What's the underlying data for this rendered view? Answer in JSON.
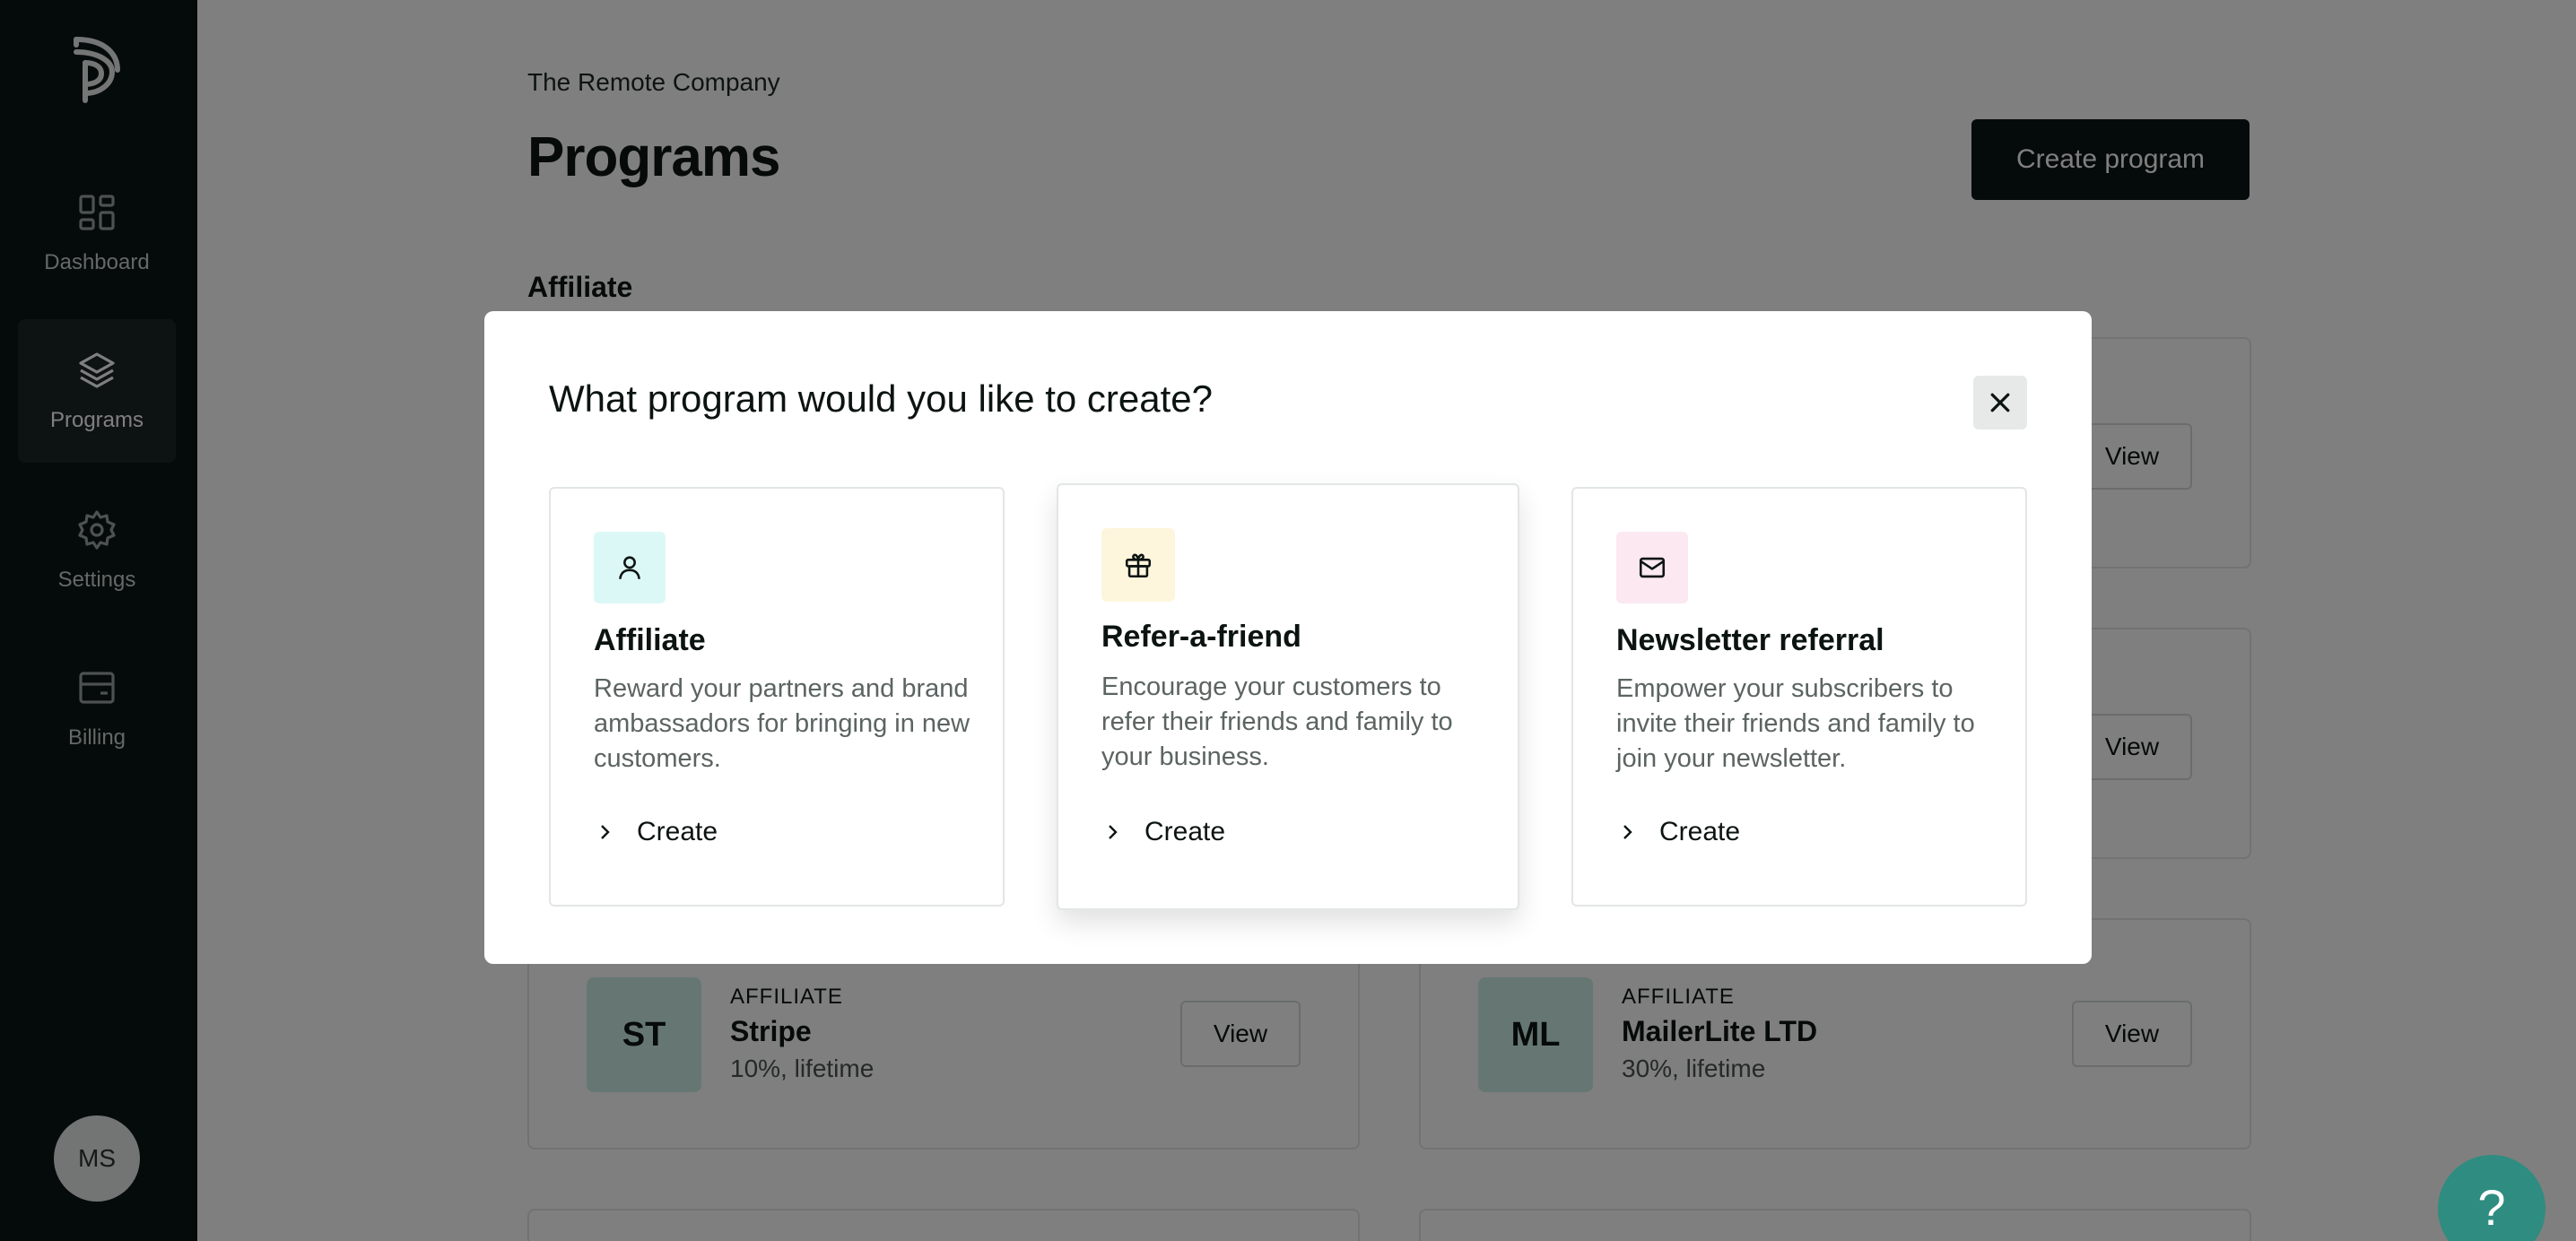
{
  "sidebar": {
    "items": [
      {
        "label": "Dashboard",
        "icon": "dashboard-icon"
      },
      {
        "label": "Programs",
        "icon": "layers-icon",
        "active": true
      },
      {
        "label": "Settings",
        "icon": "gear-icon"
      },
      {
        "label": "Billing",
        "icon": "billing-icon"
      }
    ],
    "avatar": "MS"
  },
  "header": {
    "company": "The Remote Company",
    "title": "Programs",
    "create_button": "Create program"
  },
  "section": {
    "title": "Affiliate"
  },
  "programs": [
    {
      "initials": "ST",
      "type": "AFFILIATE",
      "name": "Stripe",
      "terms": "10%, lifetime",
      "action": "View"
    },
    {
      "initials": "ML",
      "type": "AFFILIATE",
      "name": "MailerLite LTD",
      "terms": "30%, lifetime",
      "action": "View"
    }
  ],
  "partial_view_buttons": [
    "View",
    "View"
  ],
  "modal": {
    "title": "What program would you like to create?",
    "options": [
      {
        "title": "Affiliate",
        "description": "Reward your partners and brand ambassadors for bringing in new customers.",
        "action": "Create",
        "icon": "person-icon",
        "color": "#dcf8f6"
      },
      {
        "title": "Refer-a-friend",
        "description": "Encourage your customers to refer their friends and family to your business.",
        "action": "Create",
        "icon": "gift-icon",
        "color": "#fdf6dc"
      },
      {
        "title": "Newsletter referral",
        "description": "Empower your subscribers to invite their friends and family to join your newsletter.",
        "action": "Create",
        "icon": "mail-icon",
        "color": "#fbe8f1"
      }
    ]
  },
  "help": "?",
  "colors": {
    "sidebar": "#0b1614",
    "primary_button": "#0b1614",
    "help": "#2f8c80"
  }
}
